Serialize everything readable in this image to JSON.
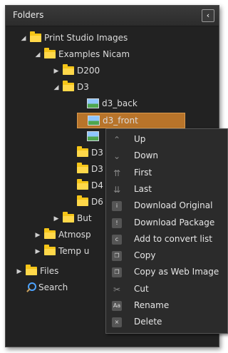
{
  "panel": {
    "title": "Folders",
    "collapse_glyph": "‹"
  },
  "tree": [
    {
      "name": "tree-node-print-studio-images",
      "label": "Print Studio Images",
      "expander": "expanded",
      "icon": "folder"
    },
    {
      "name": "tree-node-examples-nicam",
      "label": "Examples Nicam",
      "expander": "expanded",
      "icon": "folder"
    },
    {
      "name": "tree-node-d200",
      "label": "D200",
      "expander": "collapsed",
      "icon": "folder"
    },
    {
      "name": "tree-node-d3",
      "label": "D3",
      "expander": "expanded",
      "icon": "folder"
    },
    {
      "name": "tree-node-d3-back",
      "label": "d3_back",
      "icon": "image"
    },
    {
      "name": "tree-node-d3-front",
      "label": "d3_front",
      "icon": "image",
      "selected": true
    },
    {
      "name": "tree-node-d3-third",
      "label": "",
      "icon": "image"
    },
    {
      "name": "tree-node-d3x",
      "label": "D3",
      "icon": "folder"
    },
    {
      "name": "tree-node-d3y",
      "label": "D3",
      "icon": "folder"
    },
    {
      "name": "tree-node-d4",
      "label": "D4",
      "icon": "folder"
    },
    {
      "name": "tree-node-d6",
      "label": "D6",
      "icon": "folder"
    },
    {
      "name": "tree-node-but",
      "label": "But",
      "expander": "collapsed",
      "icon": "folder"
    },
    {
      "name": "tree-node-atmosp",
      "label": "Atmosp",
      "expander": "collapsed",
      "icon": "folder"
    },
    {
      "name": "tree-node-temp-u",
      "label": "Temp u",
      "expander": "collapsed",
      "icon": "folder"
    },
    {
      "name": "tree-node-files",
      "label": "Files",
      "expander": "collapsed",
      "icon": "folder"
    },
    {
      "name": "tree-node-search",
      "label": "Search",
      "icon": "search"
    }
  ],
  "context_menu": {
    "items": [
      {
        "name": "menu-item-up",
        "label": "Up",
        "icon": "chevron-up-icon",
        "glyph": "⌃"
      },
      {
        "name": "menu-item-down",
        "label": "Down",
        "icon": "chevron-down-icon",
        "glyph": "⌄"
      },
      {
        "name": "menu-item-first",
        "label": "First",
        "icon": "double-chevron-up-icon",
        "glyph": "⇈"
      },
      {
        "name": "menu-item-last",
        "label": "Last",
        "icon": "double-chevron-down-icon",
        "glyph": "⇊"
      },
      {
        "name": "menu-item-download-original",
        "label": "Download Original",
        "icon": "download-original-icon",
        "glyph": "i"
      },
      {
        "name": "menu-item-download-package",
        "label": "Download Package",
        "icon": "download-package-icon",
        "glyph": "!"
      },
      {
        "name": "menu-item-add-to-convert-list",
        "label": "Add to convert list",
        "icon": "convert-icon",
        "glyph": "c"
      },
      {
        "name": "menu-item-copy",
        "label": "Copy",
        "icon": "copy-icon",
        "glyph": "❐"
      },
      {
        "name": "menu-item-copy-as-web-image",
        "label": "Copy as Web Image",
        "icon": "copy-web-icon",
        "glyph": "❐"
      },
      {
        "name": "menu-item-cut",
        "label": "Cut",
        "icon": "scissors-icon",
        "glyph": "✂"
      },
      {
        "name": "menu-item-rename",
        "label": "Rename",
        "icon": "rename-icon",
        "glyph": "Aa"
      },
      {
        "name": "menu-item-delete",
        "label": "Delete",
        "icon": "delete-icon",
        "glyph": "×"
      }
    ]
  }
}
